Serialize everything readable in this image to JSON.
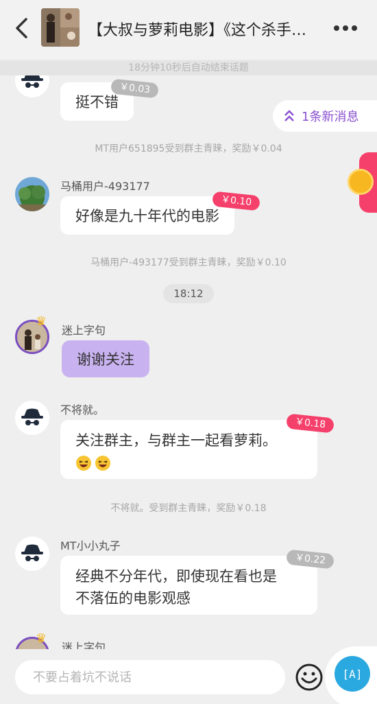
{
  "header": {
    "title": "【大叔与萝莉电影】《这个杀手…",
    "back_icon": "back-chevron-icon",
    "more_icon": "more-dots-icon"
  },
  "countdown": "18分钟10秒后自动结束话题",
  "new_messages": "1条新消息",
  "messages": [
    {
      "id": "m0",
      "user": "",
      "text": "挺不错",
      "reward": "￥0.03",
      "tag_style": "gray"
    },
    {
      "id": "s0",
      "system": "MT用户651895受到群主青睐，奖励￥0.04"
    },
    {
      "id": "m1",
      "user": "马桶用户-493177",
      "text": "好像是九十年代的电影",
      "reward": "￥0.10",
      "tag_style": "pink"
    },
    {
      "id": "s1",
      "system": "马桶用户-493177受到群主青睐，奖励￥0.10"
    },
    {
      "id": "t0",
      "time": "18:12"
    },
    {
      "id": "m2",
      "user": "迷上字句",
      "text": "谢谢关注",
      "owner": true
    },
    {
      "id": "m3",
      "user": "不将就。",
      "text": "关注群主，与群主一起看萝莉。",
      "emoji_count": 2,
      "reward": "￥0.18",
      "tag_style": "pink"
    },
    {
      "id": "s2",
      "system": "不将就。受到群主青睐，奖励￥0.18"
    },
    {
      "id": "m4",
      "user": "MT小小丸子",
      "text": "经典不分年代，即使现在看也是",
      "text2": "不落伍的电影观感",
      "reward": "￥0.22",
      "tag_style": "gray"
    },
    {
      "id": "m5",
      "user": "迷上字句"
    }
  ],
  "input": {
    "placeholder": "不要占着坑不说话",
    "emoji_icon": "emoji-icon",
    "assist_label": "[A]"
  },
  "colors": {
    "owner_bubble": "#c9b2f0",
    "reward_pink": "#f5406b",
    "reward_gray": "#b8b8b8",
    "accent_purple": "#8a50d0",
    "assist_blue": "#2aa8e0"
  }
}
